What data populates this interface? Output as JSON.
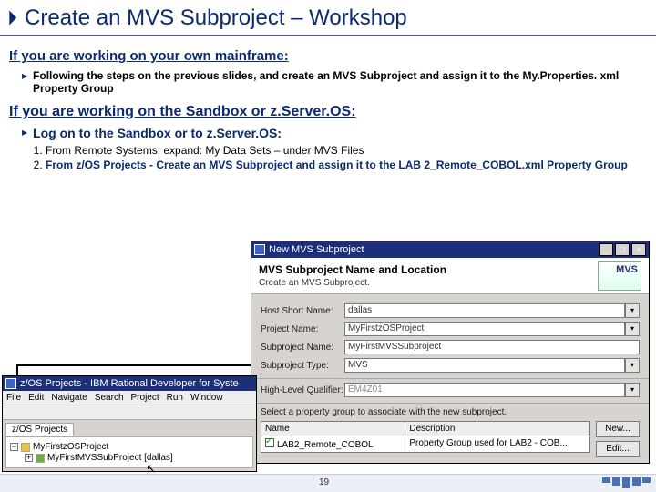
{
  "title": "Create an MVS Subproject – Workshop",
  "sections": {
    "own": {
      "heading": "If you are working on your own mainframe:",
      "line": "Following the steps on the previous slides, and create an MVS Subproject and assign it to the My.Properties. xml Property Group"
    },
    "sandbox": {
      "heading": "If you are working on the Sandbox or z.Server.OS:",
      "subheading": "Log on to the Sandbox or to z.Server.OS:",
      "steps": [
        "From Remote Systems, expand: My Data Sets – under MVS Files",
        "From z/OS Projects - Create an MVS Subproject and assign it to the LAB 2_Remote_COBOL.xml Property Group"
      ]
    }
  },
  "dialog": {
    "windowTitle": "New MVS Subproject",
    "heading": "MVS Subproject Name and Location",
    "sub": "Create an MVS Subproject.",
    "fields": {
      "hostLabel": "Host Short Name:",
      "hostVal": "dallas",
      "projLabel": "Project Name:",
      "projVal": "MyFirstzOSProject",
      "subpLabel": "Subproject Name:",
      "subpVal": "MyFirstMVSSubproject",
      "typeLabel": "Subproject Type:",
      "typeVal": "MVS",
      "hlqLabel": "High-Level Qualifier:",
      "hlqVal": "EM4Z01"
    },
    "pgLabel": "Select a property group to associate with the new subproject.",
    "table": {
      "cols": [
        "Name",
        "Description"
      ],
      "rowName": "LAB2_Remote_COBOL",
      "rowDesc": "Property Group used for LAB2 - COB..."
    },
    "buttons": {
      "new": "New...",
      "edit": "Edit..."
    }
  },
  "appwin": {
    "title": "z/OS Projects - IBM Rational Developer for Syste",
    "menus": [
      "File",
      "Edit",
      "Navigate",
      "Search",
      "Project",
      "Run",
      "Window"
    ],
    "tab": "z/OS Projects",
    "tree": {
      "root": "MyFirstzOSProject",
      "child": "MyFirstMVSSubProject  [dallas]"
    }
  },
  "page": "19"
}
